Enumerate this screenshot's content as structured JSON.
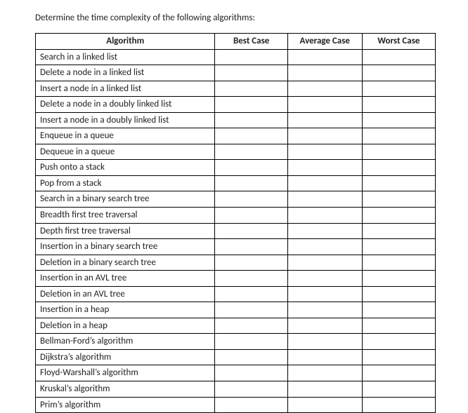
{
  "prompt": "Determine the time complexity of the following algorithms:",
  "headers": {
    "algorithm": "Algorithm",
    "best": "Best Case",
    "average": "Average Case",
    "worst": "Worst Case"
  },
  "rows": [
    {
      "algorithm": "Search in a linked list",
      "best": "",
      "average": "",
      "worst": ""
    },
    {
      "algorithm": "Delete a node in a linked list",
      "best": "",
      "average": "",
      "worst": ""
    },
    {
      "algorithm": "Insert a node in a linked list",
      "best": "",
      "average": "",
      "worst": ""
    },
    {
      "algorithm": "Delete a node in a doubly linked list",
      "best": "",
      "average": "",
      "worst": ""
    },
    {
      "algorithm": "Insert a node in a doubly linked list",
      "best": "",
      "average": "",
      "worst": ""
    },
    {
      "algorithm": "Enqueue in a queue",
      "best": "",
      "average": "",
      "worst": ""
    },
    {
      "algorithm": "Dequeue in a queue",
      "best": "",
      "average": "",
      "worst": ""
    },
    {
      "algorithm": "Push onto a stack",
      "best": "",
      "average": "",
      "worst": ""
    },
    {
      "algorithm": "Pop from a stack",
      "best": "",
      "average": "",
      "worst": ""
    },
    {
      "algorithm": "Search in a binary search tree",
      "best": "",
      "average": "",
      "worst": ""
    },
    {
      "algorithm": "Breadth first tree traversal",
      "best": "",
      "average": "",
      "worst": ""
    },
    {
      "algorithm": "Depth first tree traversal",
      "best": "",
      "average": "",
      "worst": ""
    },
    {
      "algorithm": "Insertion in a binary search tree",
      "best": "",
      "average": "",
      "worst": ""
    },
    {
      "algorithm": "Deletion in a binary search tree",
      "best": "",
      "average": "",
      "worst": ""
    },
    {
      "algorithm": "Insertion in an AVL tree",
      "best": "",
      "average": "",
      "worst": ""
    },
    {
      "algorithm": "Deletion in an AVL tree",
      "best": "",
      "average": "",
      "worst": ""
    },
    {
      "algorithm": "Insertion in a heap",
      "best": "",
      "average": "",
      "worst": ""
    },
    {
      "algorithm": "Deletion in a heap",
      "best": "",
      "average": "",
      "worst": ""
    },
    {
      "algorithm": "Bellman-Ford’s algorithm",
      "best": "",
      "average": "",
      "worst": ""
    },
    {
      "algorithm": "Dijkstra’s algorithm",
      "best": "",
      "average": "",
      "worst": ""
    },
    {
      "algorithm": "Floyd-Warshall’s algorithm",
      "best": "",
      "average": "",
      "worst": ""
    },
    {
      "algorithm": "Kruskal’s algorithm",
      "best": "",
      "average": "",
      "worst": ""
    },
    {
      "algorithm": "Prim’s algorithm",
      "best": "",
      "average": "",
      "worst": ""
    }
  ]
}
